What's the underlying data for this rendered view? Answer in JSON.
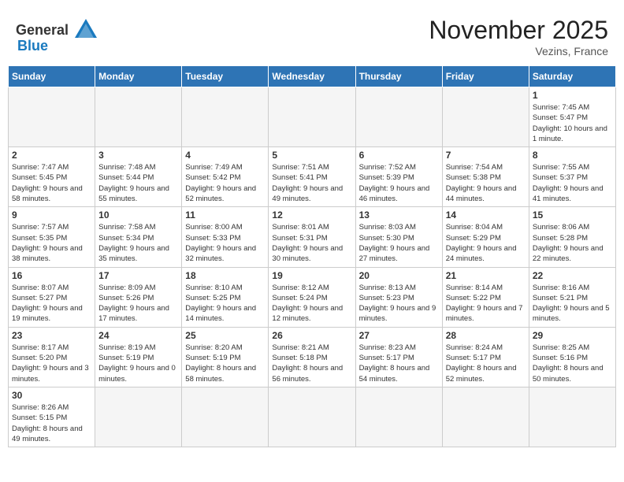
{
  "header": {
    "logo_general": "General",
    "logo_blue": "Blue",
    "title": "November 2025",
    "location": "Vezins, France"
  },
  "days_of_week": [
    "Sunday",
    "Monday",
    "Tuesday",
    "Wednesday",
    "Thursday",
    "Friday",
    "Saturday"
  ],
  "weeks": [
    [
      {
        "day": "",
        "info": ""
      },
      {
        "day": "",
        "info": ""
      },
      {
        "day": "",
        "info": ""
      },
      {
        "day": "",
        "info": ""
      },
      {
        "day": "",
        "info": ""
      },
      {
        "day": "",
        "info": ""
      },
      {
        "day": "1",
        "info": "Sunrise: 7:45 AM\nSunset: 5:47 PM\nDaylight: 10 hours and 1 minute."
      }
    ],
    [
      {
        "day": "2",
        "info": "Sunrise: 7:47 AM\nSunset: 5:45 PM\nDaylight: 9 hours and 58 minutes."
      },
      {
        "day": "3",
        "info": "Sunrise: 7:48 AM\nSunset: 5:44 PM\nDaylight: 9 hours and 55 minutes."
      },
      {
        "day": "4",
        "info": "Sunrise: 7:49 AM\nSunset: 5:42 PM\nDaylight: 9 hours and 52 minutes."
      },
      {
        "day": "5",
        "info": "Sunrise: 7:51 AM\nSunset: 5:41 PM\nDaylight: 9 hours and 49 minutes."
      },
      {
        "day": "6",
        "info": "Sunrise: 7:52 AM\nSunset: 5:39 PM\nDaylight: 9 hours and 46 minutes."
      },
      {
        "day": "7",
        "info": "Sunrise: 7:54 AM\nSunset: 5:38 PM\nDaylight: 9 hours and 44 minutes."
      },
      {
        "day": "8",
        "info": "Sunrise: 7:55 AM\nSunset: 5:37 PM\nDaylight: 9 hours and 41 minutes."
      }
    ],
    [
      {
        "day": "9",
        "info": "Sunrise: 7:57 AM\nSunset: 5:35 PM\nDaylight: 9 hours and 38 minutes."
      },
      {
        "day": "10",
        "info": "Sunrise: 7:58 AM\nSunset: 5:34 PM\nDaylight: 9 hours and 35 minutes."
      },
      {
        "day": "11",
        "info": "Sunrise: 8:00 AM\nSunset: 5:33 PM\nDaylight: 9 hours and 32 minutes."
      },
      {
        "day": "12",
        "info": "Sunrise: 8:01 AM\nSunset: 5:31 PM\nDaylight: 9 hours and 30 minutes."
      },
      {
        "day": "13",
        "info": "Sunrise: 8:03 AM\nSunset: 5:30 PM\nDaylight: 9 hours and 27 minutes."
      },
      {
        "day": "14",
        "info": "Sunrise: 8:04 AM\nSunset: 5:29 PM\nDaylight: 9 hours and 24 minutes."
      },
      {
        "day": "15",
        "info": "Sunrise: 8:06 AM\nSunset: 5:28 PM\nDaylight: 9 hours and 22 minutes."
      }
    ],
    [
      {
        "day": "16",
        "info": "Sunrise: 8:07 AM\nSunset: 5:27 PM\nDaylight: 9 hours and 19 minutes."
      },
      {
        "day": "17",
        "info": "Sunrise: 8:09 AM\nSunset: 5:26 PM\nDaylight: 9 hours and 17 minutes."
      },
      {
        "day": "18",
        "info": "Sunrise: 8:10 AM\nSunset: 5:25 PM\nDaylight: 9 hours and 14 minutes."
      },
      {
        "day": "19",
        "info": "Sunrise: 8:12 AM\nSunset: 5:24 PM\nDaylight: 9 hours and 12 minutes."
      },
      {
        "day": "20",
        "info": "Sunrise: 8:13 AM\nSunset: 5:23 PM\nDaylight: 9 hours and 9 minutes."
      },
      {
        "day": "21",
        "info": "Sunrise: 8:14 AM\nSunset: 5:22 PM\nDaylight: 9 hours and 7 minutes."
      },
      {
        "day": "22",
        "info": "Sunrise: 8:16 AM\nSunset: 5:21 PM\nDaylight: 9 hours and 5 minutes."
      }
    ],
    [
      {
        "day": "23",
        "info": "Sunrise: 8:17 AM\nSunset: 5:20 PM\nDaylight: 9 hours and 3 minutes."
      },
      {
        "day": "24",
        "info": "Sunrise: 8:19 AM\nSunset: 5:19 PM\nDaylight: 9 hours and 0 minutes."
      },
      {
        "day": "25",
        "info": "Sunrise: 8:20 AM\nSunset: 5:19 PM\nDaylight: 8 hours and 58 minutes."
      },
      {
        "day": "26",
        "info": "Sunrise: 8:21 AM\nSunset: 5:18 PM\nDaylight: 8 hours and 56 minutes."
      },
      {
        "day": "27",
        "info": "Sunrise: 8:23 AM\nSunset: 5:17 PM\nDaylight: 8 hours and 54 minutes."
      },
      {
        "day": "28",
        "info": "Sunrise: 8:24 AM\nSunset: 5:17 PM\nDaylight: 8 hours and 52 minutes."
      },
      {
        "day": "29",
        "info": "Sunrise: 8:25 AM\nSunset: 5:16 PM\nDaylight: 8 hours and 50 minutes."
      }
    ],
    [
      {
        "day": "30",
        "info": "Sunrise: 8:26 AM\nSunset: 5:15 PM\nDaylight: 8 hours and 49 minutes."
      },
      {
        "day": "",
        "info": ""
      },
      {
        "day": "",
        "info": ""
      },
      {
        "day": "",
        "info": ""
      },
      {
        "day": "",
        "info": ""
      },
      {
        "day": "",
        "info": ""
      },
      {
        "day": "",
        "info": ""
      }
    ]
  ]
}
